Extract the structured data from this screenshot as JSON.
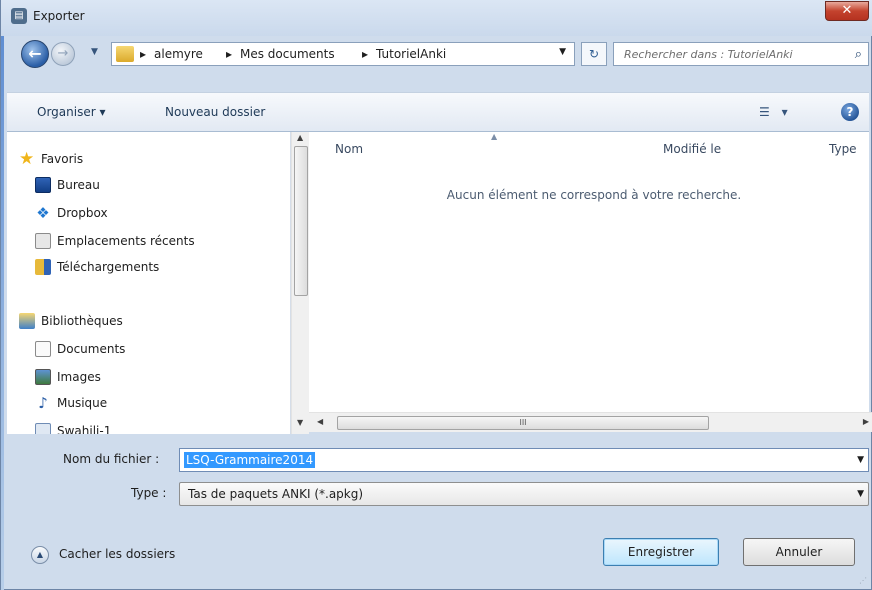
{
  "window": {
    "title": "Exporter",
    "close_label": "✕"
  },
  "navigation": {
    "back_label": "←",
    "forward_label": "→",
    "breadcrumbs": [
      "alemyre",
      "Mes documents",
      "TutorielAnki"
    ],
    "separator": "▸",
    "search_placeholder": "Rechercher dans : TutorielAnki"
  },
  "toolbar": {
    "organize_label": "Organiser ▾",
    "new_folder_label": "Nouveau dossier",
    "view_label": "▾"
  },
  "sidebar": {
    "favorites_label": "Favoris",
    "favorites": [
      {
        "label": "Bureau",
        "icon": "desktop-icon"
      },
      {
        "label": "Dropbox",
        "icon": "dropbox-icon"
      },
      {
        "label": "Emplacements récents",
        "icon": "recent-places-icon"
      },
      {
        "label": "Téléchargements",
        "icon": "downloads-icon"
      }
    ],
    "libraries_label": "Bibliothèques",
    "libraries": [
      {
        "label": "Documents",
        "icon": "documents-icon"
      },
      {
        "label": "Images",
        "icon": "pictures-icon"
      },
      {
        "label": "Musique",
        "icon": "music-icon"
      },
      {
        "label": "Swahili-1",
        "icon": "library-icon"
      }
    ]
  },
  "file_list": {
    "columns": [
      "Nom",
      "Modifié le",
      "Type"
    ],
    "empty_message": "Aucun élément ne correspond à votre recherche.",
    "scroll_grip": "III"
  },
  "form": {
    "filename_label": "Nom du fichier :",
    "filename_value": "LSQ-Grammaire2014",
    "type_label": "Type :",
    "type_value": "Tas de paquets ANKI (*.apkg)"
  },
  "footer": {
    "hide_folders_label": "Cacher les dossiers",
    "save_label": "Enregistrer",
    "cancel_label": "Annuler"
  },
  "colors": {
    "chrome": "#cfdcec",
    "selection": "#3399ff",
    "close": "#c4432e"
  }
}
